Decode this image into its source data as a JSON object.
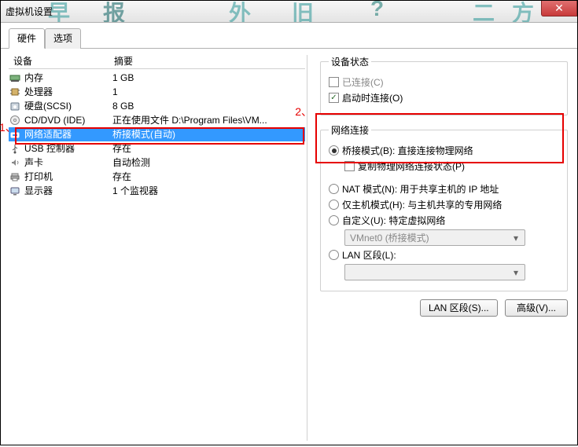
{
  "window": {
    "title": "虚拟机设置"
  },
  "tabs": [
    {
      "label": "硬件",
      "active": true
    },
    {
      "label": "选项",
      "active": false
    }
  ],
  "device_list": {
    "headers": {
      "device": "设备",
      "summary": "摘要"
    },
    "items": [
      {
        "icon": "memory-icon",
        "name": "内存",
        "summary": "1 GB"
      },
      {
        "icon": "cpu-icon",
        "name": "处理器",
        "summary": "1"
      },
      {
        "icon": "disk-icon",
        "name": "硬盘(SCSI)",
        "summary": "8 GB"
      },
      {
        "icon": "cd-icon",
        "name": "CD/DVD (IDE)",
        "summary": "正在使用文件 D:\\Program Files\\VM..."
      },
      {
        "icon": "network-icon",
        "name": "网络适配器",
        "summary": "桥接模式(自动)"
      },
      {
        "icon": "usb-icon",
        "name": "USB 控制器",
        "summary": "存在"
      },
      {
        "icon": "sound-icon",
        "name": "声卡",
        "summary": "自动检测"
      },
      {
        "icon": "printer-icon",
        "name": "打印机",
        "summary": "存在"
      },
      {
        "icon": "display-icon",
        "name": "显示器",
        "summary": "1 个监视器"
      }
    ],
    "selected_index": 4
  },
  "device_status": {
    "legend": "设备状态",
    "connected": {
      "label": "已连接(C)",
      "checked": false,
      "enabled": false
    },
    "connect_at_power_on": {
      "label": "启动时连接(O)",
      "checked": true
    }
  },
  "network_connection": {
    "legend": "网络连接",
    "selected": "bridged",
    "bridged": {
      "label": "桥接模式(B): 直接连接物理网络",
      "replicate": {
        "label": "复制物理网络连接状态(P)",
        "checked": false
      }
    },
    "nat": {
      "label": "NAT 模式(N): 用于共享主机的 IP 地址"
    },
    "host": {
      "label": "仅主机模式(H): 与主机共享的专用网络"
    },
    "custom": {
      "label": "自定义(U): 特定虚拟网络",
      "select_value": "VMnet0 (桥接模式)"
    },
    "lan_segment": {
      "label": "LAN 区段(L):",
      "select_value": ""
    }
  },
  "buttons": {
    "lan_segments": "LAN 区段(S)...",
    "advanced": "高级(V)..."
  },
  "annotations": {
    "one": "1、",
    "two": "2、"
  }
}
